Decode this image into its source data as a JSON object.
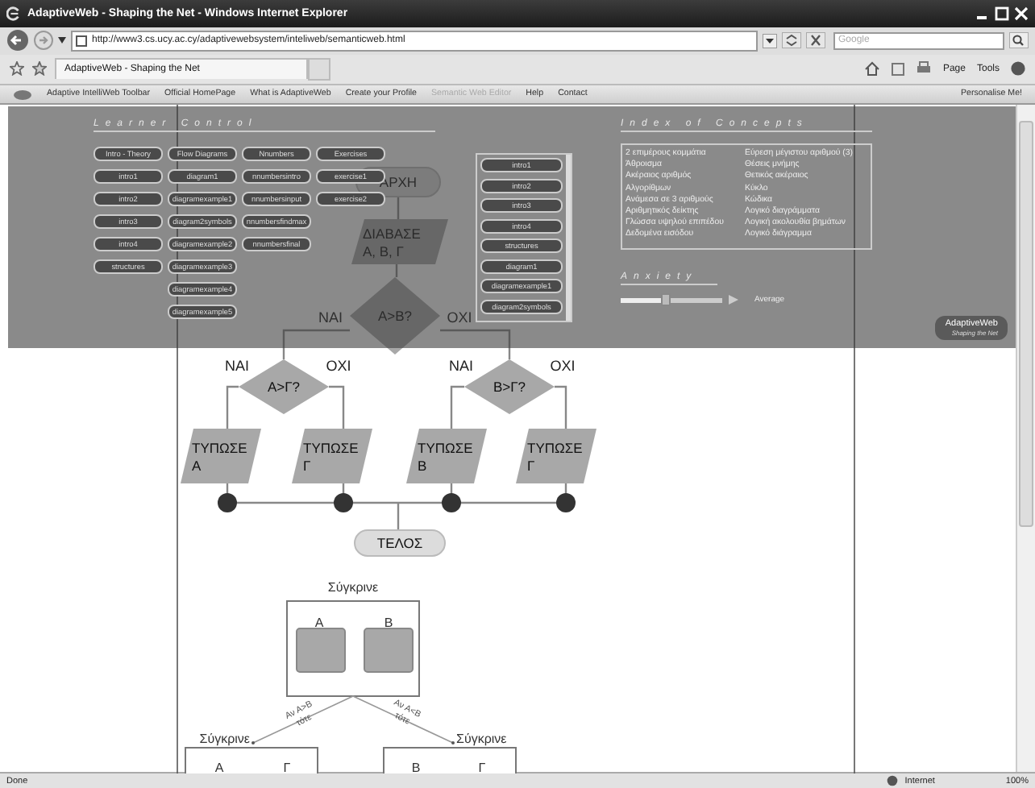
{
  "window": {
    "title": "AdaptiveWeb - Shaping the Net - Windows Internet Explorer"
  },
  "address_bar": {
    "url": "http://www3.cs.ucy.ac.cy/adaptivewebsystem/inteliweb/semanticweb.html"
  },
  "search": {
    "placeholder": "Google"
  },
  "tabs": [
    {
      "label": "AdaptiveWeb - Shaping the Net",
      "selected": true
    }
  ],
  "command_bar": [
    "Page",
    "Tools"
  ],
  "links_toolbar": {
    "title": "Adaptive IntelliWeb Toolbar",
    "links": [
      {
        "label": "Official HomePage",
        "disabled": false
      },
      {
        "label": "What is AdaptiveWeb",
        "disabled": false
      },
      {
        "label": "Create your Profile",
        "disabled": false
      },
      {
        "label": "Semantic Web Editor",
        "disabled": true
      },
      {
        "label": "Help",
        "disabled": false
      },
      {
        "label": "Contact",
        "disabled": false
      }
    ],
    "personalise": "Personalise Me!"
  },
  "learner_control": {
    "title": "Learner Control",
    "columns": [
      [
        "Intro - Theory",
        "intro1",
        "intro2",
        "intro3",
        "intro4",
        "structures"
      ],
      [
        "Flow Diagrams",
        "diagram1",
        "diagramexample1",
        "diagram2symbols",
        "diagramexample2",
        "diagramexample3",
        "diagramexample4",
        "diagramexample5"
      ],
      [
        "Nnumbers",
        "nnumbersintro",
        "nnumbersinput",
        "nnumbersfindmax",
        "nnumbersfinal"
      ],
      [
        "Exercises",
        "exercise1",
        "exercise2"
      ]
    ]
  },
  "topic_list": [
    "intro1",
    "intro2",
    "intro3",
    "intro4",
    "structures",
    "diagram1",
    "diagramexample1",
    "diagram2symbols"
  ],
  "index_of_concepts": {
    "title": "Index of Concepts",
    "items": [
      "2 επιμέρους κομμάτια",
      "Εύρεση μέγιστου αριθμού (3)",
      "Άθροισμα",
      "Θέσεις μνήμης",
      "Ακέραιος αριθμός",
      "Θετικός ακέραιος",
      "Αλγορίθμων",
      "Κύκλο",
      "Ανάμεσα σε 3 αριθμούς",
      "Κώδικα",
      "Αριθμητικός δείκτης",
      "Λογικό διαγράμματα",
      "Γλώσσα υψηλού επιπέδου",
      "Λογική ακολουθία βημάτων",
      "Δεδομένα εισόδου",
      "Λογικό διάγραμμα"
    ]
  },
  "anxiety": {
    "title": "Anxiety",
    "level": 0.45,
    "reading": "Average"
  },
  "logo": {
    "name": "AdaptiveWeb",
    "tagline": "Shaping the Net"
  },
  "flowchart": {
    "nodes": [
      {
        "kind": "terminal",
        "lines": [
          "ΑΡΧΗ"
        ]
      },
      {
        "kind": "io",
        "lines": [
          "ΔΙΑΒΑΣΕ",
          "Α, Β, Γ"
        ]
      },
      {
        "kind": "decision",
        "lines": [
          "Α>Β?"
        ]
      },
      {
        "kind": "decision",
        "lines": [
          "Α>Γ?"
        ]
      },
      {
        "kind": "decision",
        "lines": [
          "Β>Γ?"
        ]
      },
      {
        "kind": "io",
        "lines": [
          "ΤΥΠΩΣΕ",
          "Α"
        ]
      },
      {
        "kind": "io",
        "lines": [
          "ΤΥΠΩΣΕ",
          "Γ"
        ]
      },
      {
        "kind": "io",
        "lines": [
          "ΤΥΠΩΣΕ",
          "Β"
        ]
      },
      {
        "kind": "io",
        "lines": [
          "ΤΥΠΩΣΕ",
          "Γ"
        ]
      },
      {
        "kind": "terminal",
        "lines": [
          "ΤΕΛΟΣ"
        ]
      }
    ],
    "branch_labels": [
      "ΝΑΙ",
      "ΟΧΙ",
      "ΝΑΙ",
      "ΟΧΙ",
      "ΝΑΙ",
      "ΟΧΙ"
    ]
  },
  "compare_diagram": {
    "title": "Σύγκρινε",
    "left": "Α",
    "right": "Β",
    "branches": [
      {
        "condition": "Αν Α>Β",
        "then": "τότε",
        "title": "Σύγκρινε",
        "left": "Α",
        "right": "Γ"
      },
      {
        "condition": "Αν Α<Β",
        "then": "τότε",
        "title": "Σύγκρινε",
        "left": "Β",
        "right": "Γ"
      }
    ]
  },
  "status_bar": {
    "text": "Done",
    "zone": "Internet",
    "zoom": "100%"
  }
}
